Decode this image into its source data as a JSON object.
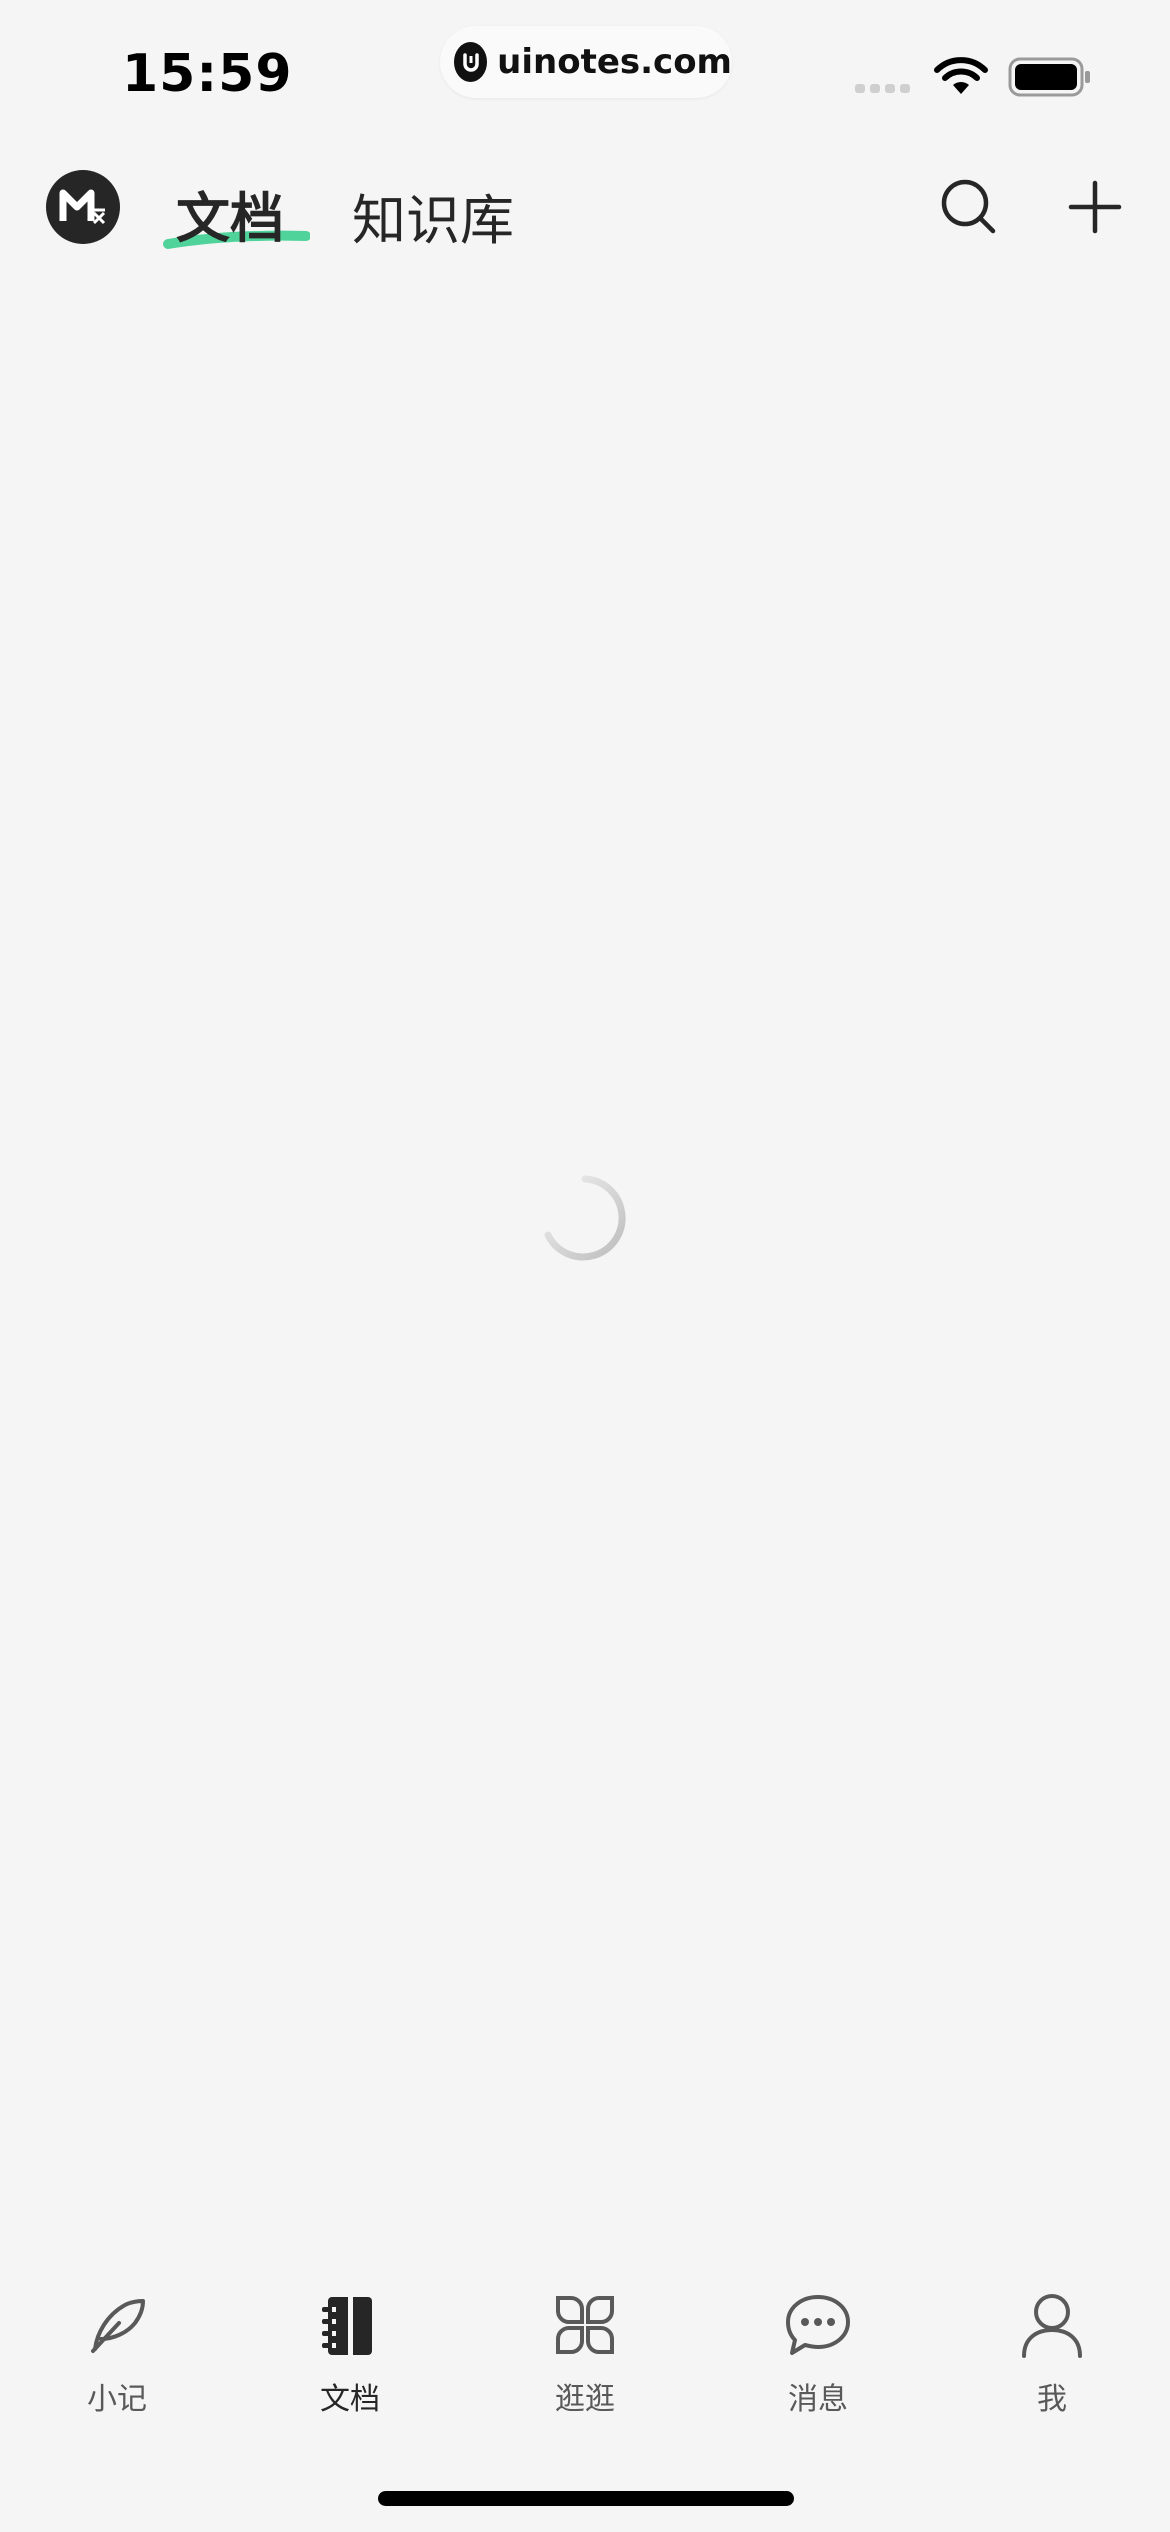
{
  "status_bar": {
    "time": "15:59",
    "url": "uinotes.com"
  },
  "header": {
    "tabs": [
      {
        "label": "文档",
        "active": true
      },
      {
        "label": "知识库",
        "active": false
      }
    ],
    "accent_color": "#4fd39a"
  },
  "bottom_nav": {
    "items": [
      {
        "label": "小记",
        "icon": "feather-icon",
        "active": false
      },
      {
        "label": "文档",
        "icon": "notebook-icon",
        "active": true
      },
      {
        "label": "逛逛",
        "icon": "explore-icon",
        "active": false
      },
      {
        "label": "消息",
        "icon": "message-icon",
        "active": false
      },
      {
        "label": "我",
        "icon": "person-icon",
        "active": false
      }
    ]
  }
}
